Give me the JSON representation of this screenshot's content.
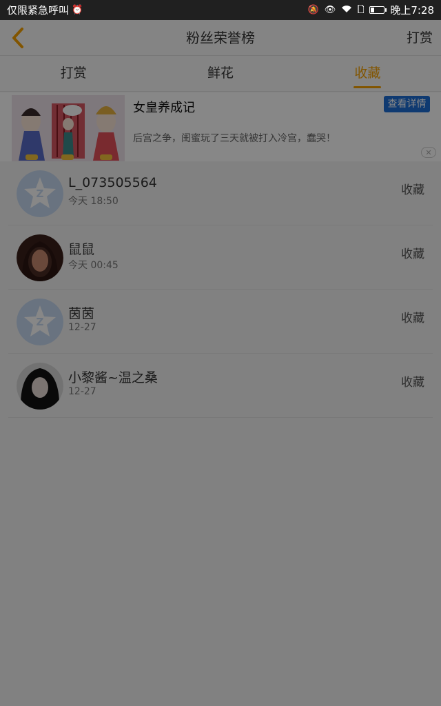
{
  "status_bar": {
    "carrier": "仅限紧急呼叫",
    "time": "晚上7:28",
    "battery_level": 0.25
  },
  "header": {
    "title": "粉丝荣誉榜",
    "action_label": "打赏",
    "back_icon": "chevron-left-icon",
    "accent_color": "#f5a000"
  },
  "tabs": [
    {
      "label": "打赏",
      "active": false
    },
    {
      "label": "鲜花",
      "active": false
    },
    {
      "label": "收藏",
      "active": true
    }
  ],
  "ad": {
    "title": "女皇养成记",
    "description": "后宫之争，闺蜜玩了三天就被打入冷宫，蠢哭！",
    "button_label": "查看详情",
    "close_icon": "close-icon"
  },
  "entries": [
    {
      "name": "L_073505564",
      "time": "今天 18:50",
      "kind": "收藏",
      "avatar": "default-qq-avatar"
    },
    {
      "name": "鼠鼠",
      "time": "今天 00:45",
      "kind": "收藏",
      "avatar": "photo-avatar"
    },
    {
      "name": "茵茵",
      "time": "12-27",
      "kind": "收藏",
      "avatar": "default-qq-avatar"
    },
    {
      "name": "小黎酱~温之桑",
      "time": "12-27",
      "kind": "收藏",
      "avatar": "photo-avatar"
    }
  ]
}
